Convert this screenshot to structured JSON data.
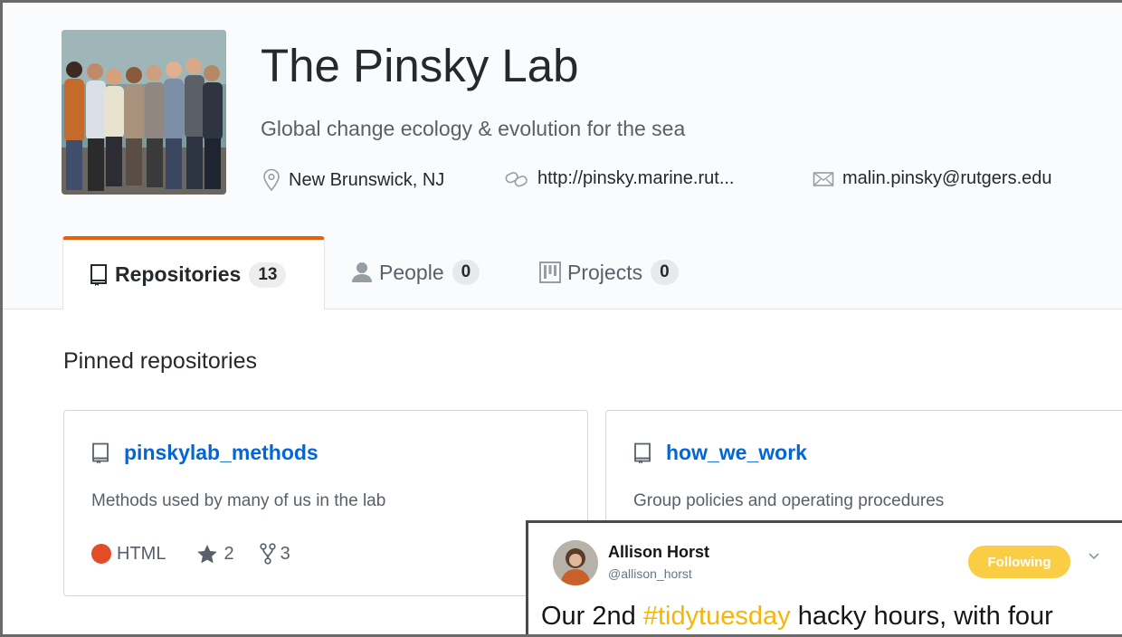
{
  "org": {
    "name": "The Pinsky Lab",
    "description": "Global change ecology & evolution for the sea",
    "location": "New Brunswick, NJ",
    "website": "http://pinsky.marine.rut...",
    "email": "malin.pinsky@rutgers.edu"
  },
  "tabs": [
    {
      "label": "Repositories",
      "count": "13",
      "icon": "repo-icon",
      "selected": true
    },
    {
      "label": "People",
      "count": "0",
      "icon": "person-icon",
      "selected": false
    },
    {
      "label": "Projects",
      "count": "0",
      "icon": "project-icon",
      "selected": false
    }
  ],
  "pinned": {
    "title": "Pinned repositories",
    "repos": [
      {
        "name": "pinskylab_methods",
        "description": "Methods used by many of us in the lab",
        "language": "HTML",
        "language_color": "#e34c26",
        "stars": "2",
        "forks": "3"
      },
      {
        "name": "how_we_work",
        "description": "Group policies and operating procedures"
      }
    ]
  },
  "tweet": {
    "name": "Allison Horst",
    "handle": "@allison_horst",
    "follow_label": "Following",
    "text_before": "Our 2nd ",
    "hashtag": "#tidytuesday",
    "text_after": " hacky hours, with four"
  },
  "colors": {
    "accent_tab": "#e36209",
    "link": "#0366d6",
    "follow": "#fbcd45",
    "hashtag": "#f5b50a"
  }
}
